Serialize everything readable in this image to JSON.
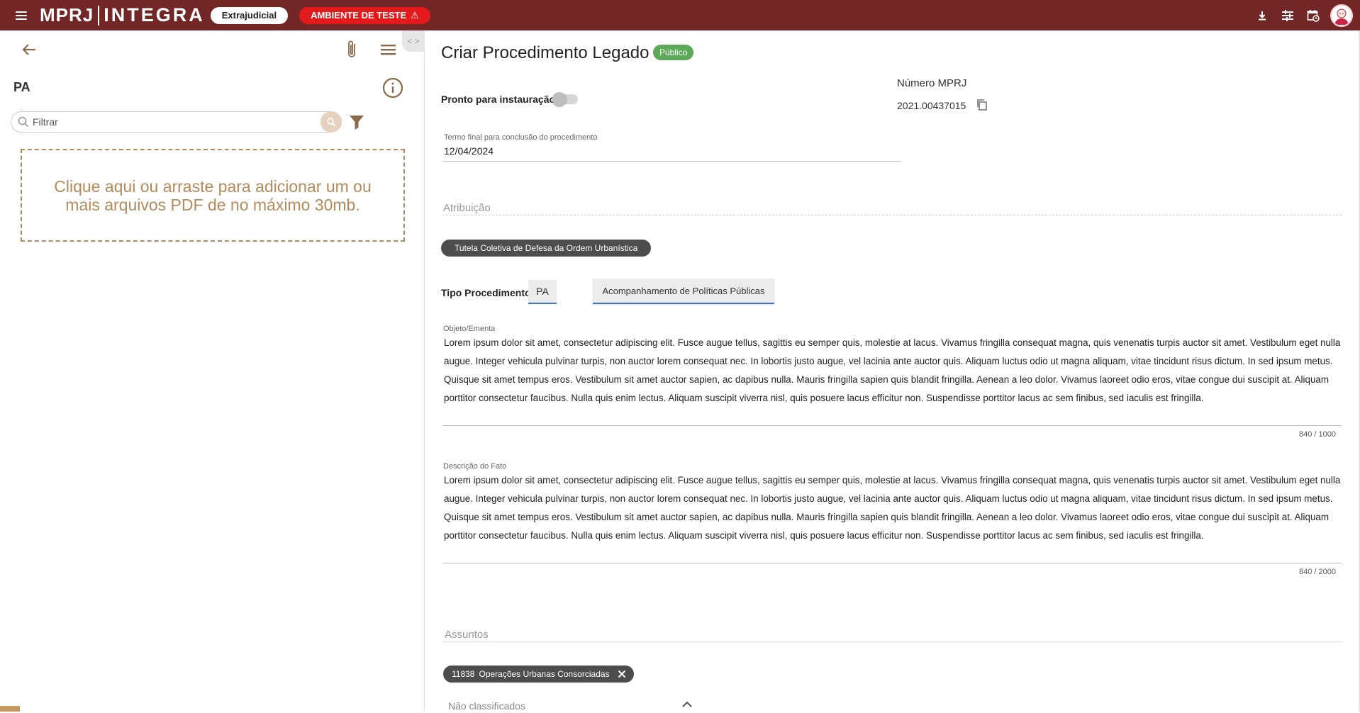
{
  "topbar": {
    "logo_mprj": "MPRJ",
    "logo_integra": "INTEGRA",
    "chip_extrajudicial": "Extrajudicial",
    "chip_ambiente": "AMBIENTE DE TESTE",
    "icons": [
      "menu-icon",
      "download-icon",
      "sliders-icon",
      "calendar-clock-icon",
      "avatar"
    ]
  },
  "left_panel": {
    "title": "PA",
    "filter_placeholder": "Filtrar",
    "dropzone_text": "Clique aqui ou arraste para adicionar um ou mais arquivos PDF de no máximo 30mb.",
    "collapse_label": "< >"
  },
  "main": {
    "title": "Criar Procedimento Legado",
    "badge": "Público",
    "pronto_label": "Pronto para instauração",
    "pronto_value": false,
    "numero_label": "Número MPRJ",
    "numero_value": "2021.00437015",
    "termo_label": "Termo final para conclusão do procedimento",
    "termo_value": "12/04/2024",
    "atribuicao_label": "Atribuição",
    "atribuicao_chip": "Tutela Coletiva de Defesa da Ordem Urbanística",
    "tipo_label": "Tipo Procedimento",
    "tipo_pa": "PA",
    "tipo_acomp": "Acompanhamento de Políticas Públicas",
    "objeto_label": "Objeto/Ementa",
    "objeto_text": "Lorem ipsum dolor sit amet, consectetur adipiscing elit. Fusce augue tellus, sagittis eu semper quis, molestie at lacus. Vivamus fringilla consequat magna, quis venenatis turpis auctor sit amet. Vestibulum eget nulla augue. Integer vehicula pulvinar turpis, non auctor lorem consequat nec. In lobortis justo augue, vel lacinia ante auctor quis. Aliquam luctus odio ut magna aliquam, vitae tincidunt risus dictum. In sed ipsum metus. Quisque sit amet tempus eros. Vestibulum sit amet auctor sapien, ac dapibus nulla. Mauris fringilla sapien quis blandit fringilla. Aenean a leo dolor. Vivamus laoreet odio eros, vitae congue dui suscipit at. Aliquam porttitor consectetur faucibus. Nulla quis enim lectus. Aliquam suscipit viverra nisl, quis posuere lacus efficitur non. Suspendisse porttitor lacus ac sem finibus, sed iaculis est fringilla.",
    "objeto_counter": "840 / 1000",
    "descricao_label": "Descrição do Fato",
    "descricao_text": "Lorem ipsum dolor sit amet, consectetur adipiscing elit. Fusce augue tellus, sagittis eu semper quis, molestie at lacus. Vivamus fringilla consequat magna, quis venenatis turpis auctor sit amet. Vestibulum eget nulla augue. Integer vehicula pulvinar turpis, non auctor lorem consequat nec. In lobortis justo augue, vel lacinia ante auctor quis. Aliquam luctus odio ut magna aliquam, vitae tincidunt risus dictum. In sed ipsum metus. Quisque sit amet tempus eros. Vestibulum sit amet auctor sapien, ac dapibus nulla. Mauris fringilla sapien quis blandit fringilla. Aenean a leo dolor. Vivamus laoreet odio eros, vitae congue dui suscipit at. Aliquam porttitor consectetur faucibus. Nulla quis enim lectus. Aliquam suscipit viverra nisl, quis posuere lacus efficitur non. Suspendisse porttitor lacus ac sem finibus, sed iaculis est fringilla.",
    "descricao_counter": "840 / 2000",
    "assuntos_label": "Assuntos",
    "assunto_code": "11838",
    "assunto_name": "Operações Urbanas Consorciadas",
    "nao_classificados": "Não classificados"
  },
  "colors": {
    "topbar": "#722626",
    "accent": "#b58a5a",
    "test_red": "#e3191b",
    "badge_green": "#5ca95a"
  }
}
